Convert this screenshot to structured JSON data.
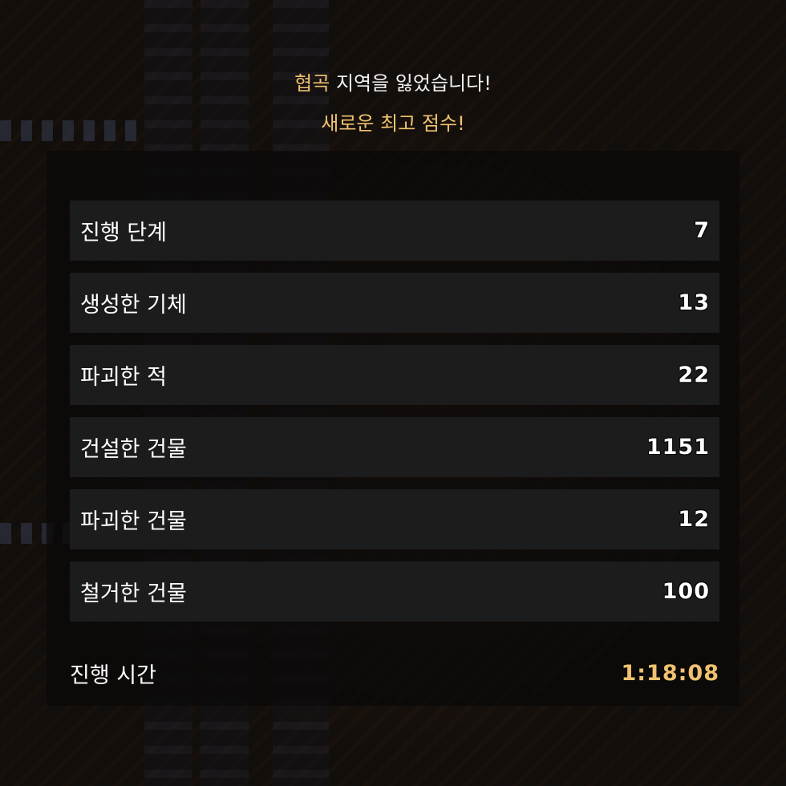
{
  "header": {
    "region_name": "협곡",
    "region_lost_suffix": " 지역을 잃었습니다!",
    "new_high_score": "새로운 최고 점수!"
  },
  "stats": [
    {
      "label": "진행 단계",
      "value": "7"
    },
    {
      "label": "생성한 기체",
      "value": "13"
    },
    {
      "label": "파괴한 적",
      "value": "22"
    },
    {
      "label": "건설한 건물",
      "value": "1151"
    },
    {
      "label": "파괴한 건물",
      "value": "12"
    },
    {
      "label": "철거한 건물",
      "value": "100"
    }
  ],
  "playtime": {
    "label": "진행 시간",
    "value": "1:18:08"
  },
  "colors": {
    "accent": "#f0c270",
    "row_background": "#1c1c1c",
    "text": "#ffffff"
  }
}
